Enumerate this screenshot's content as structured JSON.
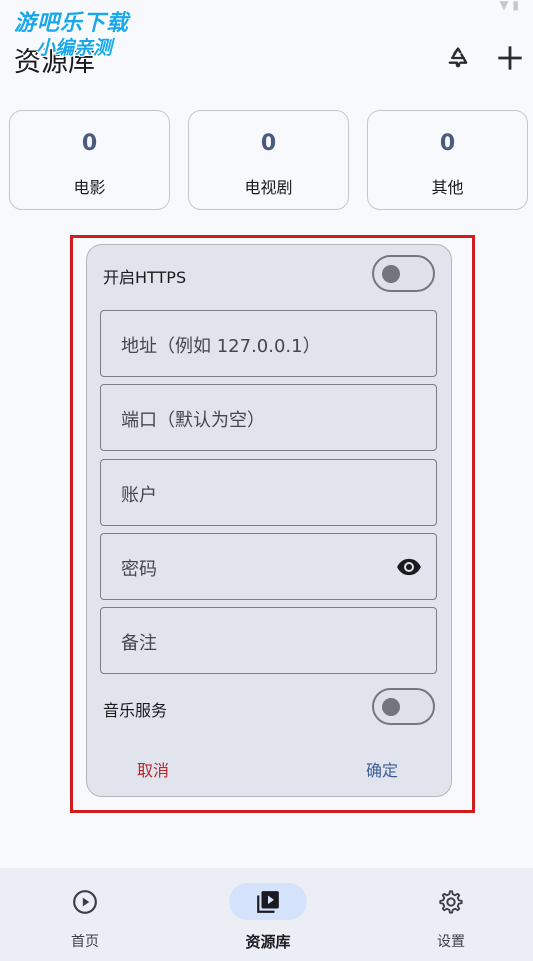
{
  "watermark": {
    "line1": "游吧乐下载",
    "line2": "小编亲测"
  },
  "header": {
    "title": "资源库",
    "refresh_icon": "sync-icon",
    "add_icon": "plus-icon"
  },
  "stats": [
    {
      "count": "0",
      "label": "电影"
    },
    {
      "count": "0",
      "label": "电视剧"
    },
    {
      "count": "0",
      "label": "其他"
    }
  ],
  "dialog": {
    "https_label": "开启HTTPS",
    "https_enabled": false,
    "fields": {
      "address_placeholder": "地址（例如 127.0.0.1）",
      "port_placeholder": "端口（默认为空）",
      "account_placeholder": "账户",
      "password_placeholder": "密码",
      "note_placeholder": "备注"
    },
    "music_label": "音乐服务",
    "music_enabled": false,
    "cancel_label": "取消",
    "confirm_label": "确定"
  },
  "bottom_nav": {
    "items": [
      {
        "label": "首页",
        "icon": "play-circle-icon",
        "active": false
      },
      {
        "label": "资源库",
        "icon": "video-library-icon",
        "active": true
      },
      {
        "label": "设置",
        "icon": "gear-icon",
        "active": false
      }
    ]
  },
  "colors": {
    "accent": "#4a5b7e",
    "cancel": "#b5272b",
    "confirm": "#3c5e96",
    "highlight_border": "#d01c1f"
  }
}
